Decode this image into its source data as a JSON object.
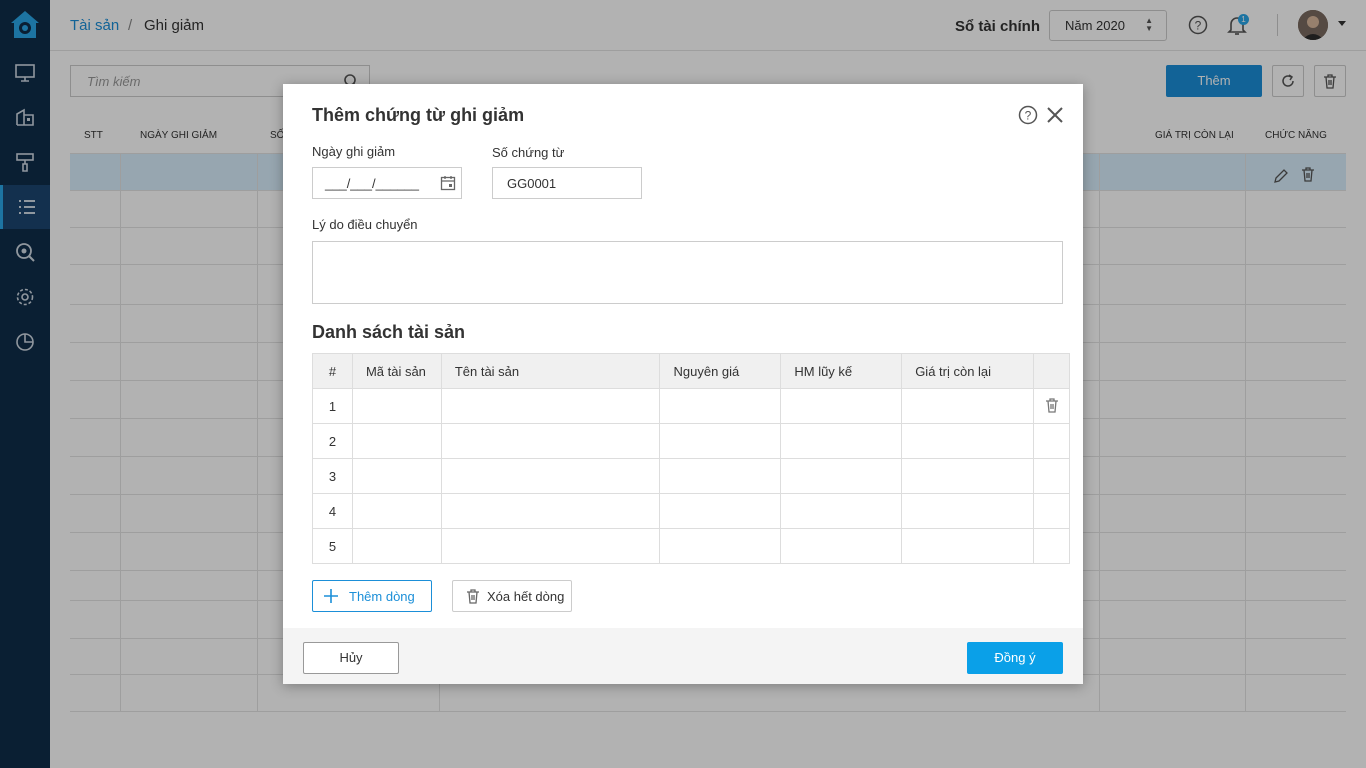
{
  "breadcrumb": {
    "root": "Tài sản",
    "separator": "/",
    "current": "Ghi giảm"
  },
  "header": {
    "book_label": "Sổ tài chính",
    "year": "Năm 2020",
    "notification_count": "1"
  },
  "background": {
    "search_placeholder": "Tìm kiếm",
    "add_label": "Thêm",
    "columns": {
      "stt": "STT",
      "date": "NGÀY GHI GIẢM",
      "so": "SỐ",
      "remaining": "GIÁ TRỊ CÒN LẠI",
      "actions": "CHỨC NĂNG"
    }
  },
  "modal": {
    "title": "Thêm chứng từ ghi giảm",
    "date_label": "Ngày ghi giảm",
    "date_value": "___/___/______",
    "doc_label": "Số chứng từ",
    "doc_value": "GG0001",
    "reason_label": "Lý do điều chuyển",
    "reason_value": "",
    "list_title": "Danh sách tài sản",
    "columns": [
      "#",
      "Mã tài sản",
      "Tên tài sản",
      "Nguyên giá",
      "HM lũy kế",
      "Giá trị còn lại"
    ],
    "rows": [
      "1",
      "2",
      "3",
      "4",
      "5"
    ],
    "add_row_label": "Thêm dòng",
    "clear_rows_label": "Xóa hết dòng",
    "cancel_label": "Hủy",
    "ok_label": "Đồng ý"
  },
  "colors": {
    "accent": "#1b8fd8",
    "sidebar": "#0f2d4a",
    "ok_button": "#0aa0e8"
  }
}
